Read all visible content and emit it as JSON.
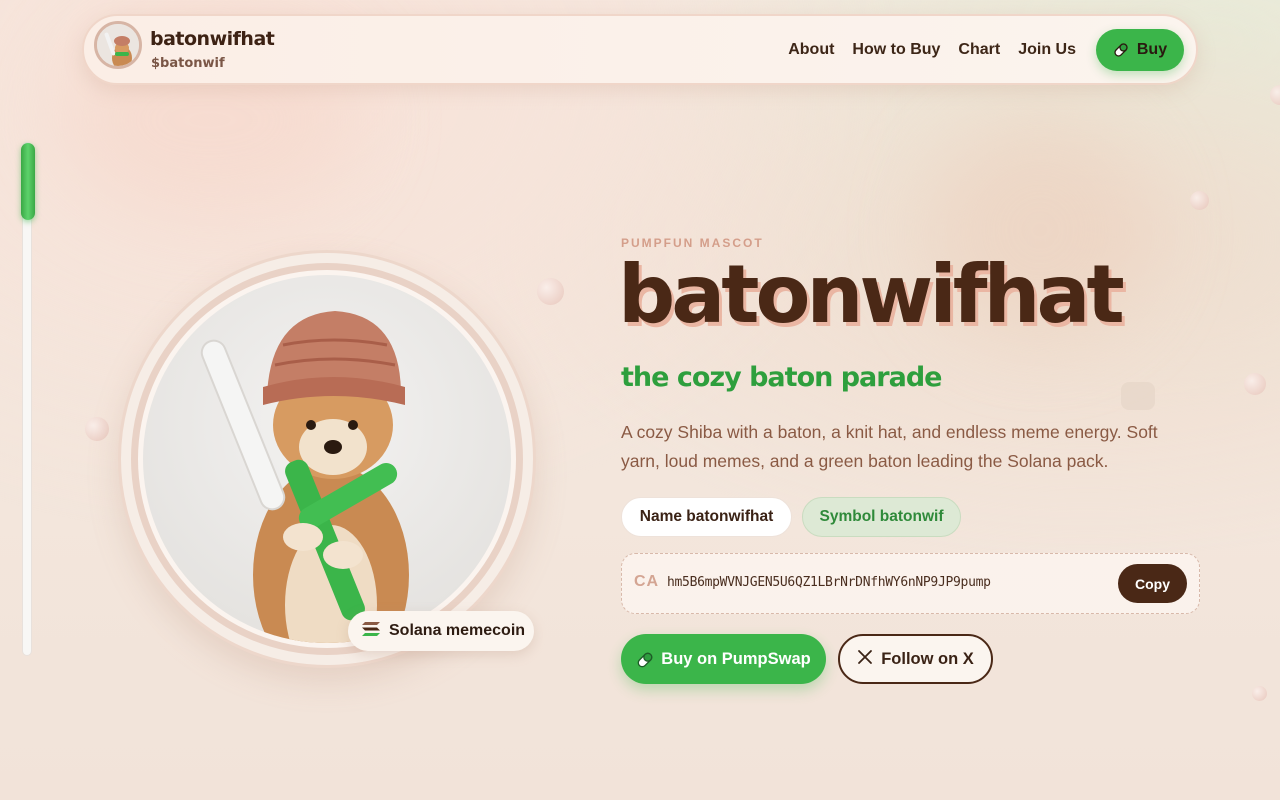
{
  "brand": {
    "name": "batonwifhat",
    "ticker": "$batonwif"
  },
  "nav": {
    "items": [
      "About",
      "How to Buy",
      "Chart",
      "Join Us"
    ],
    "buy_label": "Buy"
  },
  "scroll_progress": 0.15,
  "hero": {
    "badge_label": "Solana memecoin",
    "eyebrow": "PUMPFUN MASCOT",
    "title": "batonwifhat",
    "subtitle": "the cozy baton parade",
    "description": "A cozy Shiba with a baton, a knit hat, and endless meme energy. Soft yarn, loud memes, and a green baton leading the Solana pack.",
    "chip_name": "Name batonwifhat",
    "chip_symbol": "Symbol batonwif",
    "ca_label": "CA",
    "ca_value": "hm5B6mpWVNJGEN5U6QZ1LBrNrDNfhWY6nNP9JP9pump",
    "copy_label": "Copy",
    "buy_pump_label": "Buy on PumpSwap",
    "follow_label": "Follow on X"
  },
  "icons": {
    "pill": "pill-icon",
    "x": "x-logo-icon",
    "solana": "solana-icon"
  },
  "colors": {
    "accent_green": "#3bb54a",
    "brand_brown": "#4a2816",
    "title_shadow": "#eab6a3",
    "background": "#f4e8df"
  }
}
